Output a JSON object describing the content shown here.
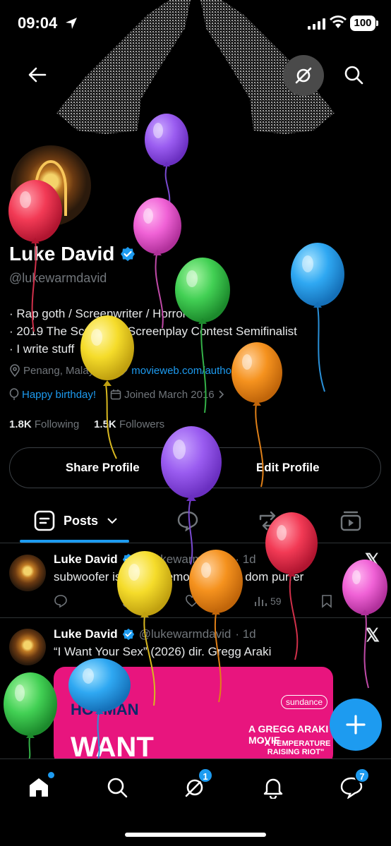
{
  "status_bar": {
    "time": "09:04",
    "battery": "100"
  },
  "profile": {
    "name": "Luke David",
    "handle": "@lukewarmdavid",
    "bio_lines": [
      "· Rap goth / Screenwriter / Horror nerd",
      "· 2019 The Script Lab Screenplay Contest Semifinalist",
      "· I write stuff"
    ],
    "location": "Penang, Malaysia",
    "website": "movieweb.com/author/luke-da...",
    "birthday": "Happy birthday!",
    "joined": "Joined March 2016",
    "following_count": "1.8K",
    "following_label": "Following",
    "followers_count": "1.5K",
    "followers_label": "Followers"
  },
  "buttons": {
    "share": "Share Profile",
    "edit": "Edit Profile"
  },
  "tabs": {
    "posts": "Posts"
  },
  "posts": [
    {
      "name": "Luke David",
      "handle": "@lukewarmdavid",
      "time": "· 1d",
      "text": "subwoofer is just the emotional of a dom purrer",
      "views": "59"
    },
    {
      "name": "Luke David",
      "handle": "@lukewarmdavid",
      "time": "· 1d",
      "text": "“I Want Your Sex” (2026) dir. Gregg Araki"
    }
  ],
  "media": {
    "festival": "sundance",
    "title_small": "A GREGG ARAKI MOVIE",
    "quote": "\"A TEMPERATURE RAISING RIOT\"",
    "poster_line1": "HOTMAN",
    "poster_line2": "WANT"
  },
  "nav": {
    "messages_badge": "1",
    "dm_badge": "7"
  },
  "colors": {
    "accent": "#1d9bf0",
    "background": "#000000",
    "muted": "#71767b"
  }
}
